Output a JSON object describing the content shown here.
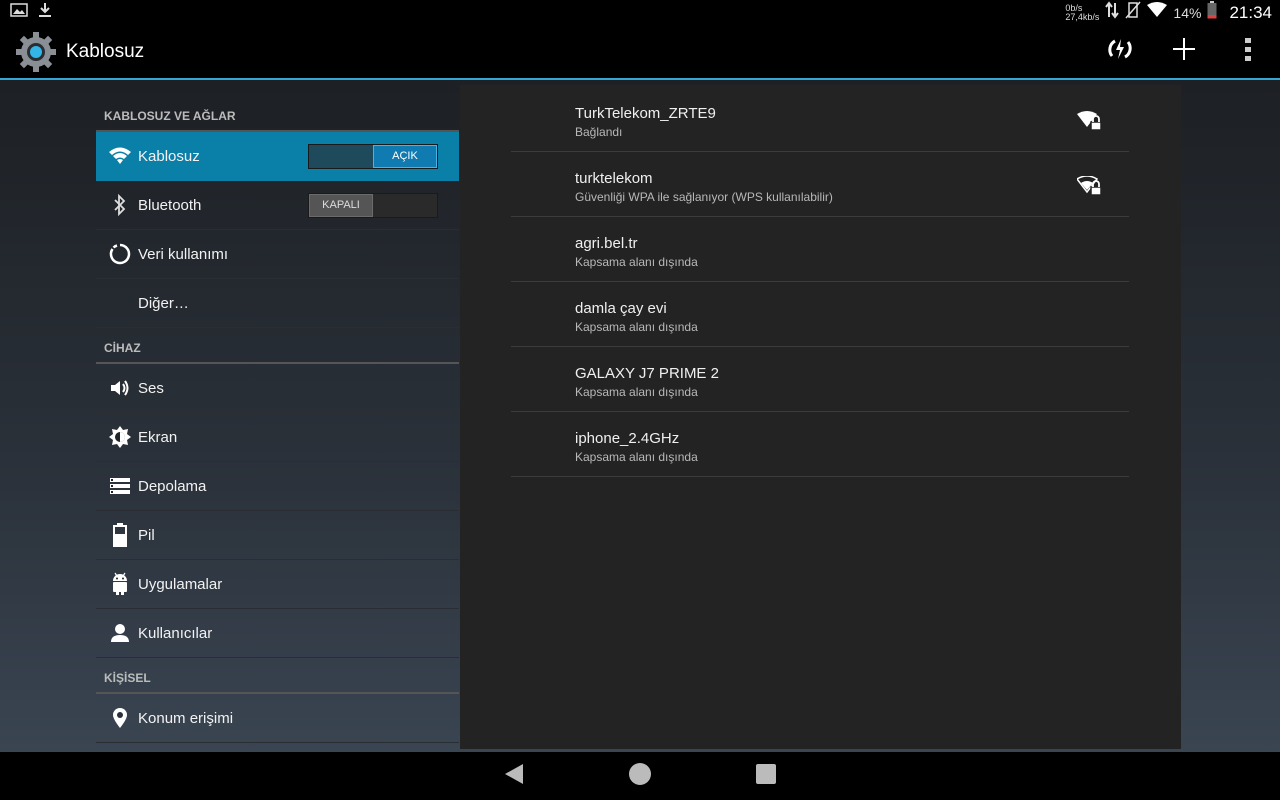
{
  "status_bar": {
    "icons_left": [
      "gallery-icon",
      "download-icon"
    ],
    "speed_up": "0b/s",
    "speed_down": "27,4kb/s",
    "battery_percent": "14%",
    "time": "21:34"
  },
  "action_bar": {
    "title": "Kablosuz",
    "actions": [
      "wps-icon",
      "add-icon",
      "overflow-menu-icon"
    ]
  },
  "sidebar": {
    "sections": [
      {
        "header": "KABLOSUZ VE AĞLAR",
        "items": [
          {
            "label": "Kablosuz",
            "icon": "wifi-icon",
            "active": true,
            "toggle": "AÇIK"
          },
          {
            "label": "Bluetooth",
            "icon": "bluetooth-icon",
            "toggle": "KAPALI"
          },
          {
            "label": "Veri kullanımı",
            "icon": "data-usage-icon"
          },
          {
            "label": "Diğer…"
          }
        ]
      },
      {
        "header": "CİHAZ",
        "items": [
          {
            "label": "Ses",
            "icon": "volume-icon"
          },
          {
            "label": "Ekran",
            "icon": "brightness-icon"
          },
          {
            "label": "Depolama",
            "icon": "storage-icon"
          },
          {
            "label": "Pil",
            "icon": "battery-icon"
          },
          {
            "label": "Uygulamalar",
            "icon": "android-icon"
          },
          {
            "label": "Kullanıcılar",
            "icon": "user-icon"
          }
        ]
      },
      {
        "header": "KİŞİSEL",
        "items": [
          {
            "label": "Konum erişimi",
            "icon": "location-icon"
          }
        ]
      }
    ]
  },
  "networks": [
    {
      "ssid": "TurkTelekom_ZRTE9",
      "status": "Bağlandı",
      "signal": "wifi-lock-icon"
    },
    {
      "ssid": "turktelekom",
      "status": "Güvenliği WPA ile sağlanıyor (WPS kullanılabilir)",
      "signal": "wifi-lock-icon"
    },
    {
      "ssid": "agri.bel.tr",
      "status": "Kapsama alanı dışında"
    },
    {
      "ssid": "damla çay evi",
      "status": "Kapsama alanı dışında"
    },
    {
      "ssid": "GALAXY J7 PRIME 2",
      "status": "Kapsama alanı dışında"
    },
    {
      "ssid": "iphone_2.4GHz",
      "status": "Kapsama alanı dışında"
    }
  ],
  "colors": {
    "accent": "#33a5d6",
    "active_item": "#0a7fa8"
  }
}
